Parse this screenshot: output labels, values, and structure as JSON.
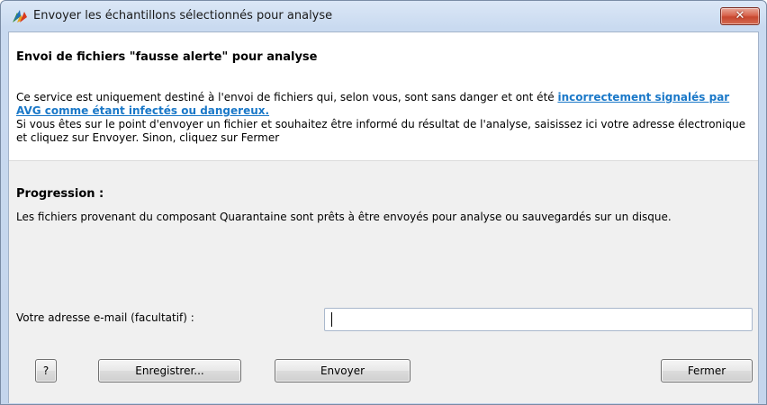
{
  "window": {
    "title": "Envoyer les échantillons sélectionnés pour analyse",
    "close_label": "✕"
  },
  "header": {
    "title": "Envoi de fichiers \"fausse alerte\" pour analyse",
    "desc_part1": "Ce service est uniquement destiné à l'envoi de fichiers qui, selon vous, sont sans danger et ont été ",
    "link_text": "incorrectement signalés par AVG comme étant infectés ou dangereux.",
    "desc_part2": " Si vous êtes sur le point d'envoyer un fichier et souhaitez être informé du résultat de l'analyse, saisissez ici votre adresse électronique et cliquez sur Envoyer. Sinon, cliquez sur Fermer"
  },
  "progress": {
    "label": "Progression :",
    "text": "Les fichiers provenant du composant Quarantaine sont prêts à être envoyés pour analyse ou sauvegardés sur un disque."
  },
  "email": {
    "label": "Votre adresse e-mail (facultatif) :",
    "value": ""
  },
  "buttons": {
    "help": "?",
    "save": "Enregistrer...",
    "send": "Envoyer",
    "close": "Fermer"
  },
  "colors": {
    "link": "#1a78c8",
    "close_button": "#c8472f"
  },
  "icons": {
    "app": "avg-logo-icon",
    "close": "close-icon"
  }
}
